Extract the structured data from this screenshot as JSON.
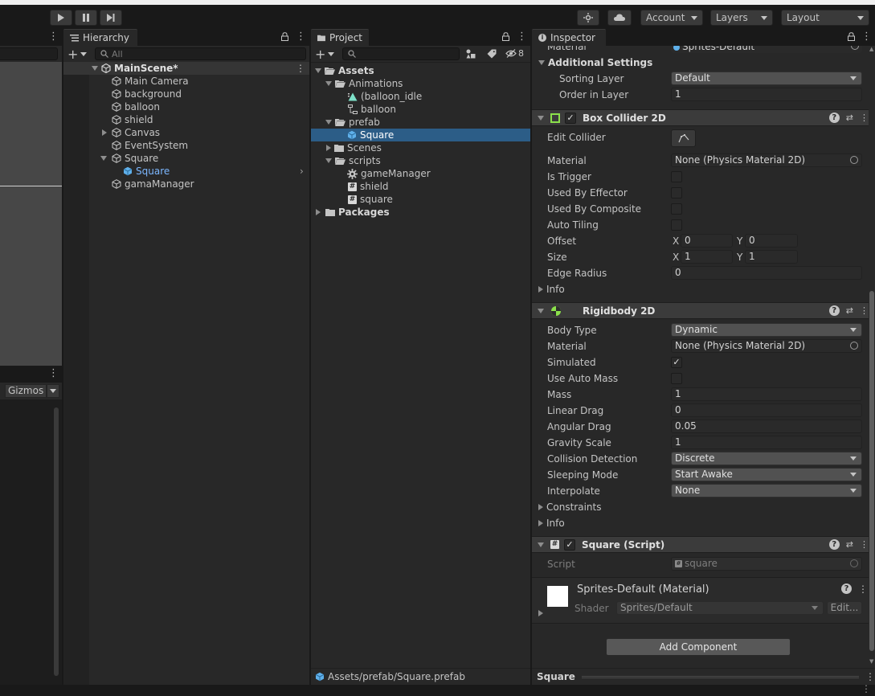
{
  "toolbar": {
    "account_label": "Account",
    "layers_label": "Layers",
    "layout_label": "Layout"
  },
  "scene_view": {
    "gizmos_label": "Gizmos"
  },
  "hierarchy": {
    "tab_label": "Hierarchy",
    "search_placeholder": "All",
    "scene_name": "MainScene*",
    "items": [
      {
        "label": "Main Camera"
      },
      {
        "label": "background"
      },
      {
        "label": "balloon"
      },
      {
        "label": "shield"
      },
      {
        "label": "Canvas"
      },
      {
        "label": "EventSystem"
      },
      {
        "label": "Square"
      },
      {
        "label": "Square"
      },
      {
        "label": "gamaManager"
      }
    ]
  },
  "project": {
    "tab_label": "Project",
    "hidden_count": "8",
    "items": [
      {
        "label": "Assets"
      },
      {
        "label": "Animations"
      },
      {
        "label": "(balloon_idle"
      },
      {
        "label": "balloon"
      },
      {
        "label": "prefab"
      },
      {
        "label": "Square"
      },
      {
        "label": "Scenes"
      },
      {
        "label": "scripts"
      },
      {
        "label": "gameManager"
      },
      {
        "label": "shield"
      },
      {
        "label": "square"
      },
      {
        "label": "Packages"
      }
    ],
    "footer_path": "Assets/prefab/Square.prefab"
  },
  "inspector": {
    "tab_label": "Inspector",
    "top_material_label": "Material",
    "top_material_value": "Sprites-Default",
    "additional_settings": {
      "title": "Additional Settings",
      "sorting_layer_label": "Sorting Layer",
      "sorting_layer_value": "Default",
      "order_label": "Order in Layer",
      "order_value": "1"
    },
    "box_collider": {
      "title": "Box Collider 2D",
      "edit_collider_label": "Edit Collider",
      "material_label": "Material",
      "material_value": "None (Physics Material 2D)",
      "is_trigger_label": "Is Trigger",
      "used_by_effector_label": "Used By Effector",
      "used_by_composite_label": "Used By Composite",
      "auto_tiling_label": "Auto Tiling",
      "offset_label": "Offset",
      "offset_x": "0",
      "offset_y": "0",
      "size_label": "Size",
      "size_x": "1",
      "size_y": "1",
      "x_label": "X",
      "y_label": "Y",
      "edge_radius_label": "Edge Radius",
      "edge_radius_value": "0",
      "info_label": "Info"
    },
    "rigidbody": {
      "title": "Rigidbody 2D",
      "body_type_label": "Body Type",
      "body_type_value": "Dynamic",
      "material_label": "Material",
      "material_value": "None (Physics Material 2D)",
      "simulated_label": "Simulated",
      "use_auto_mass_label": "Use Auto Mass",
      "mass_label": "Mass",
      "mass_value": "1",
      "linear_drag_label": "Linear Drag",
      "linear_drag_value": "0",
      "angular_drag_label": "Angular Drag",
      "angular_drag_value": "0.05",
      "gravity_scale_label": "Gravity Scale",
      "gravity_scale_value": "1",
      "collision_detection_label": "Collision Detection",
      "collision_detection_value": "Discrete",
      "sleeping_mode_label": "Sleeping Mode",
      "sleeping_mode_value": "Start Awake",
      "interpolate_label": "Interpolate",
      "interpolate_value": "None",
      "constraints_label": "Constraints",
      "info_label": "Info"
    },
    "script": {
      "title": "Square (Script)",
      "script_label": "Script",
      "script_value": "square"
    },
    "material": {
      "title": "Sprites-Default (Material)",
      "shader_label": "Shader",
      "shader_value": "Sprites/Default",
      "edit_label": "Edit..."
    },
    "add_component_label": "Add Component",
    "footer_title": "Square"
  }
}
